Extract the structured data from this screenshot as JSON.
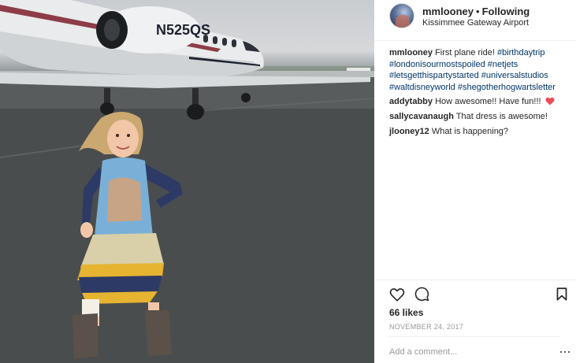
{
  "post": {
    "image": {
      "plane_registration": "N525QS"
    },
    "author": {
      "username": "mmlooney",
      "separator": "•",
      "follow_status": "Following",
      "location": "Kissimmee Gateway Airport"
    },
    "caption": {
      "username": "mmlooney",
      "text": "First plane ride!",
      "hashtags": [
        "#birthdaytrip",
        "#londonisourmostspoiled",
        "#netjets",
        "#letsgetthispartystarted",
        "#universalstudios",
        "#waltdisneyworld",
        "#shegotherhogwartsletter"
      ]
    },
    "comments": [
      {
        "username": "addytabby",
        "text": "How awesome!! Have fun!!!",
        "emoji": "red-heart"
      },
      {
        "username": "sallycavanaugh",
        "text": "That dress is awesome!"
      },
      {
        "username": "jlooney12",
        "text": "What is happening?"
      }
    ],
    "actions": {
      "like_icon": "heart-outline-icon",
      "comment_icon": "comment-bubble-icon",
      "save_icon": "bookmark-icon"
    },
    "likes": "66 likes",
    "date": "NOVEMBER 24, 2017",
    "add_comment": {
      "placeholder": "Add a comment...",
      "value": ""
    },
    "more_icon": "ellipsis-icon"
  },
  "colors": {
    "text": "#262626",
    "hashtag": "#003569",
    "muted": "#999999",
    "divider": "#efefef",
    "heart": "#ed4956"
  }
}
